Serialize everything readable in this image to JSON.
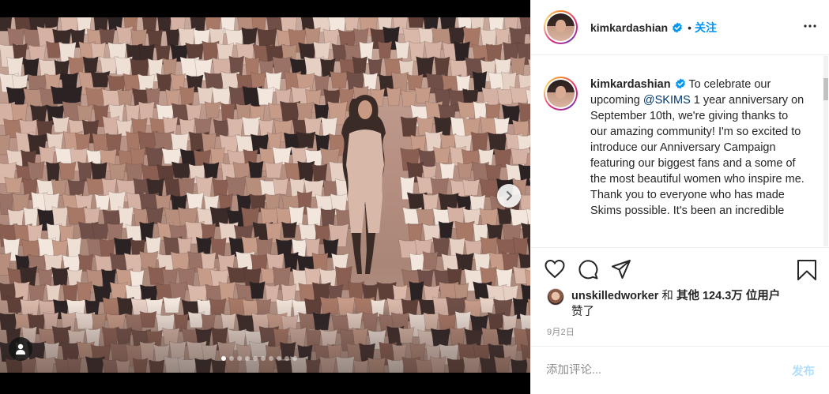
{
  "post": {
    "author": "kimkardashian",
    "verified": true,
    "follow_separator": "•",
    "follow_label": "关注",
    "more_icon": "ellipsis-icon",
    "image_count": 10,
    "active_image_index": 0
  },
  "caption": {
    "username": "kimkardashian",
    "text_before_mention": " To celebrate our upcoming ",
    "mention": "@SKIMS",
    "text_after_mention": " 1 year anniversary on September 10th, we're giving thanks to our amazing community! I'm so excited to introduce our Anniversary Campaign featuring our biggest fans and a some of the most beautiful women who inspire me. Thank you to everyone who has made Skims possible. It's been an incredible"
  },
  "likes": {
    "liker": "unskilledworker",
    "connector": " 和 ",
    "others": "其他 124.3万 位用户",
    "suffix": "赞了"
  },
  "date": "9月2日",
  "comment": {
    "placeholder": "添加评论...",
    "post_label": "发布"
  },
  "colors": {
    "accent": "#0095f6",
    "post_disabled": "#b2dffc",
    "mention": "#00376b",
    "muted": "#8e8e8e"
  }
}
